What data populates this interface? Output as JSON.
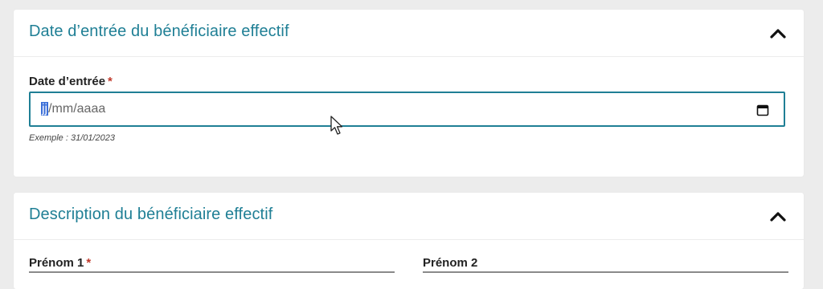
{
  "sections": [
    {
      "title": "Date d’entrée du bénéficiaire effectif",
      "collapse_icon": "chevron-up-icon",
      "fields": [
        {
          "label": "Date d’entrée",
          "required_mark": "*",
          "value_segments": [
            "jj",
            "/mm/aaaa"
          ],
          "calendar_icon": "calendar-icon",
          "hint": "Exemple : 31/01/2023"
        }
      ]
    },
    {
      "title": "Description du bénéficiaire effectif",
      "collapse_icon": "chevron-up-icon",
      "fields": [
        {
          "label": "Prénom 1",
          "required_mark": "*"
        },
        {
          "label": "Prénom 2"
        }
      ]
    }
  ],
  "colors": {
    "accent": "#1f7f95",
    "required": "#c0392b",
    "background": "#ececec",
    "panel": "#ffffff"
  }
}
